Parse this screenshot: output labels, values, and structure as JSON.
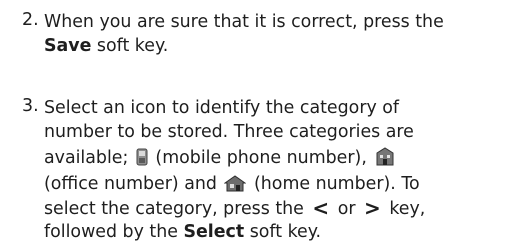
{
  "step2": {
    "number": "2.",
    "line1": "When you are sure that it is correct, press the",
    "bold": "Save",
    "line2_rest": " soft key."
  },
  "step3": {
    "number": "3.",
    "line1": "Select an icon to identify the category of",
    "line2": "number to be stored. Three categories are",
    "line3a": "available; ",
    "line3b": " (mobile phone number), ",
    "line4a": " (office number) and ",
    "line4b": " (home number). To",
    "line5a": "select the category, press the ",
    "line5b": " or ",
    "line5c": " key,",
    "line6a": "followed by the ",
    "line6bold": "Select",
    "line6b": " soft key.",
    "left_arrow": "<",
    "right_arrow": ">"
  },
  "icons": {
    "mobile": "mobile-phone-icon",
    "office": "office-building-icon",
    "home": "home-icon"
  }
}
